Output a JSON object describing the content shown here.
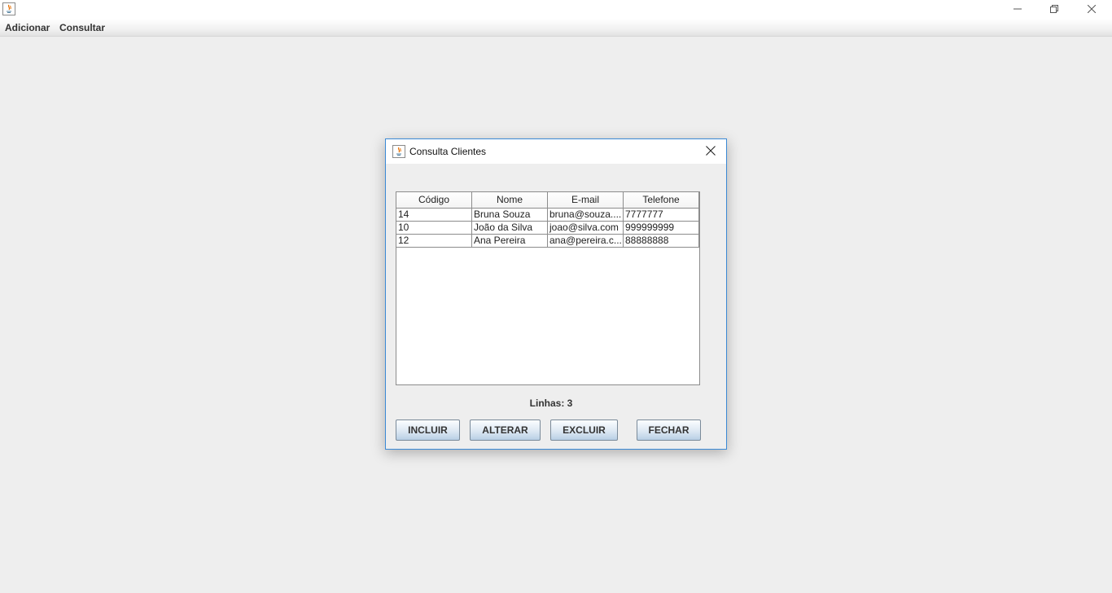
{
  "window": {
    "icon": "java-icon",
    "controls": [
      "minimize-icon",
      "maximize-icon",
      "close-icon"
    ]
  },
  "menubar": {
    "items": [
      "Adicionar",
      "Consultar"
    ]
  },
  "dialog": {
    "title": "Consulta Clientes",
    "icon": "java-icon",
    "table": {
      "columns": [
        "Código",
        "Nome",
        "E-mail",
        "Telefone"
      ],
      "rows": [
        [
          "14",
          "Bruna Souza",
          "bruna@souza....",
          "7777777"
        ],
        [
          "10",
          "João da Silva",
          "joao@silva.com",
          "999999999"
        ],
        [
          "12",
          "Ana Pereira",
          "ana@pereira.c...",
          "88888888"
        ]
      ]
    },
    "row_count_label": "Linhas: 3",
    "buttons": {
      "incluir": "INCLUIR",
      "alterar": "ALTERAR",
      "excluir": "EXCLUIR",
      "fechar": "FECHAR"
    }
  }
}
